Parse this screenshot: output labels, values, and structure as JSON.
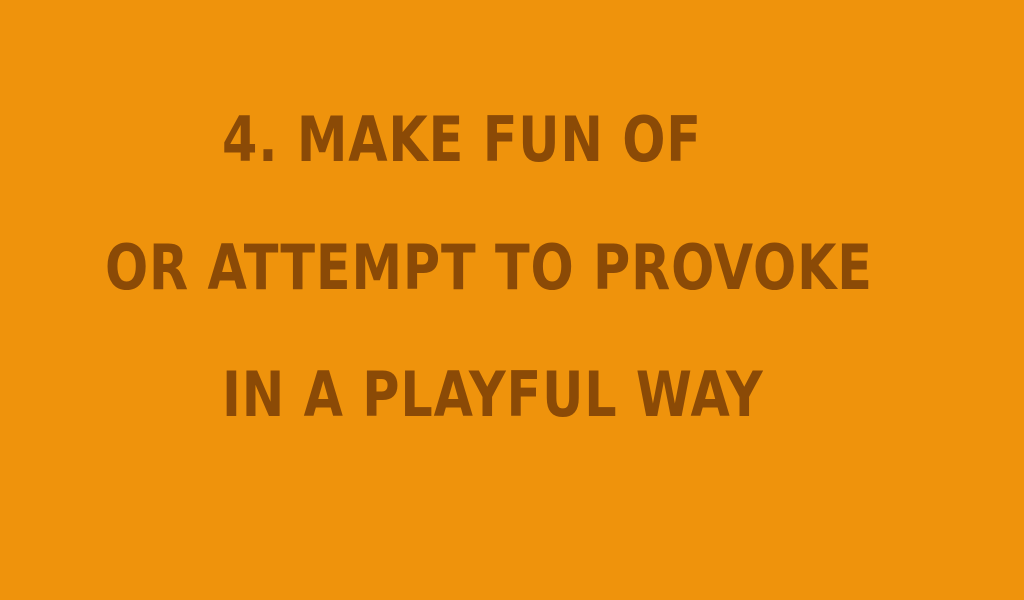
{
  "colors": {
    "background": "#EF930C",
    "text": "#8B4A06"
  },
  "slide": {
    "lines": [
      "4. MAKE FUN OF",
      "OR ATTEMPT TO PROVOKE",
      "iN A PLAYFUL WAY"
    ]
  }
}
